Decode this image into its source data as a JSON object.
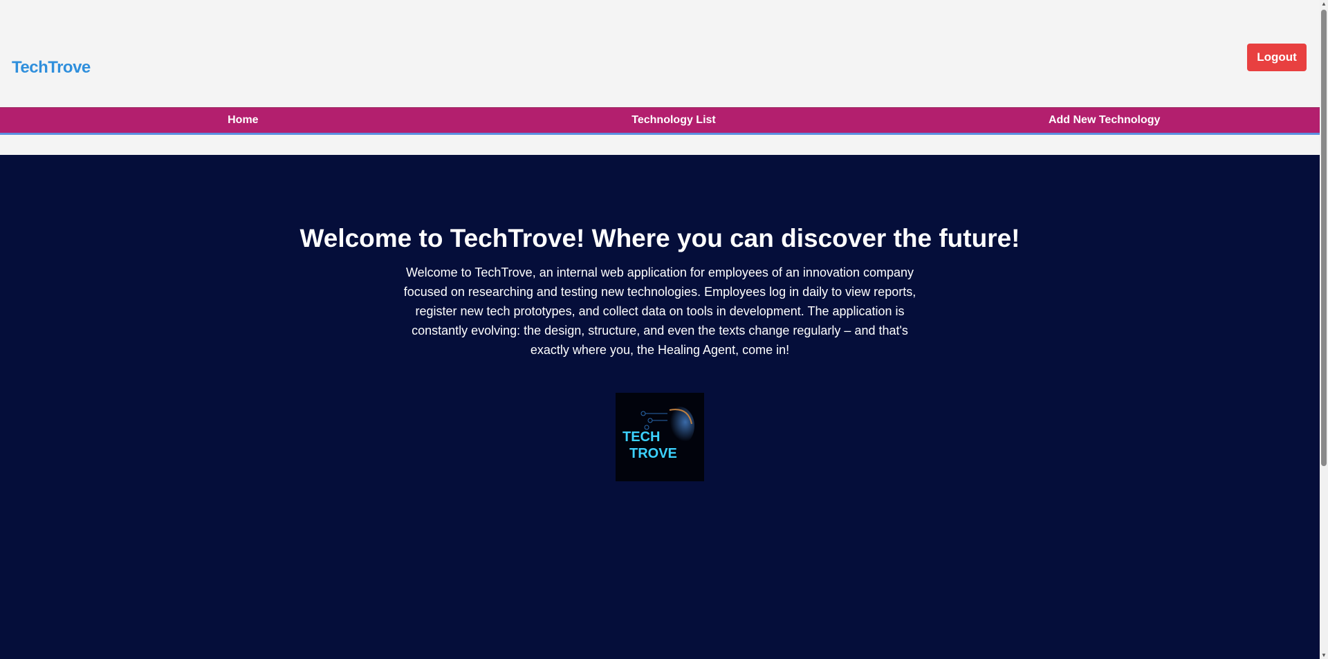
{
  "header": {
    "brand": "TechTrove",
    "logout_label": "Logout"
  },
  "nav": {
    "items": [
      {
        "label": "Home"
      },
      {
        "label": "Technology List"
      },
      {
        "label": "Add New Technology"
      }
    ]
  },
  "main": {
    "title": "Welcome to TechTrove! Where you can discover the future!",
    "description": "Welcome to TechTrove, an internal web application for employees of an innovation company focused on researching and testing new technologies. Employees log in daily to view reports, register new tech prototypes, and collect data on tools in development. The application is constantly evolving: the design, structure, and even the texts change regularly – and that's exactly where you, the Healing Agent, come in!",
    "logo_text": "TECH TROVE"
  },
  "colors": {
    "brand": "#2f8fdc",
    "nav": "#b31f6e",
    "logout": "#e84040",
    "hero_bg": "#050e3a"
  }
}
